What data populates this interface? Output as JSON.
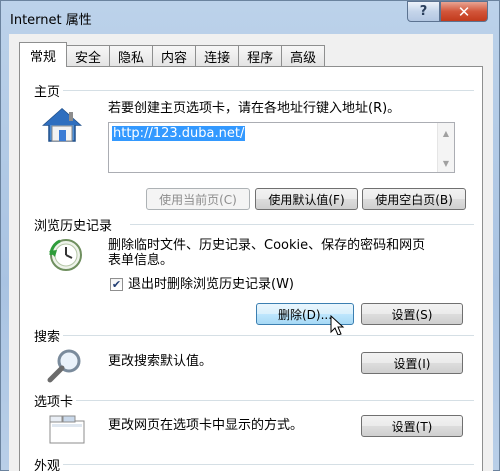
{
  "window": {
    "title": "Internet 属性",
    "help_label": "?",
    "close_label": "✕"
  },
  "tabs": [
    {
      "label": "常规",
      "active": true
    },
    {
      "label": "安全"
    },
    {
      "label": "隐私"
    },
    {
      "label": "内容"
    },
    {
      "label": "连接"
    },
    {
      "label": "程序"
    },
    {
      "label": "高级"
    }
  ],
  "homepage": {
    "group_label": "主页",
    "description": "若要创建主页选项卡，请在各地址行键入地址(R)。",
    "url": "http://123.duba.net/",
    "use_current_label": "使用当前页(C)",
    "use_default_label": "使用默认值(F)",
    "use_blank_label": "使用空白页(B)"
  },
  "history": {
    "group_label": "浏览历史记录",
    "description_line1": "删除临时文件、历史记录、Cookie、保存的密码和网页",
    "description_line2": "表单信息。",
    "checkbox_label": "退出时删除浏览历史记录(W)",
    "checkbox_checked": true,
    "delete_label": "删除(D)...",
    "settings_label": "设置(S)"
  },
  "search": {
    "group_label": "搜索",
    "description": "更改搜索默认值。",
    "settings_label": "设置(I)"
  },
  "tabs_group": {
    "group_label": "选项卡",
    "description": "更改网页在选项卡中显示的方式。",
    "settings_label": "设置(T)"
  },
  "appearance": {
    "group_label": "外观"
  }
}
